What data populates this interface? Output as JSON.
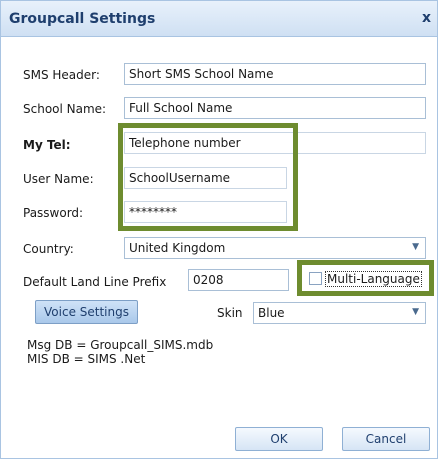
{
  "window": {
    "title": "Groupcall Settings",
    "close_glyph": "x"
  },
  "form": {
    "sms_header": {
      "label": "SMS Header:",
      "value": "Short SMS School Name"
    },
    "school_name": {
      "label": "School Name:",
      "value": "Full School Name"
    },
    "my_tel": {
      "label": "My Tel:",
      "value": "Telephone number"
    },
    "user_name": {
      "label": "User Name:",
      "value": "SchoolUsername"
    },
    "password": {
      "label": "Password:",
      "value": "********"
    },
    "country": {
      "label": "Country:",
      "value": "United Kingdom"
    },
    "land_line_prefix": {
      "label": "Default Land Line Prefix",
      "value": "0208"
    },
    "multi_language": {
      "label": "Multi-Language",
      "checked": false
    },
    "skin": {
      "label": "Skin",
      "value": "Blue"
    }
  },
  "buttons": {
    "voice_settings": "Voice Settings",
    "ok": "OK",
    "cancel": "Cancel"
  },
  "info": {
    "msg_db": "Msg DB = Groupcall_SIMS.mdb",
    "mis_db": "MIS DB = SIMS .Net"
  },
  "colors": {
    "highlight": "#6e8c2f",
    "title_text": "#1f3f6e"
  }
}
